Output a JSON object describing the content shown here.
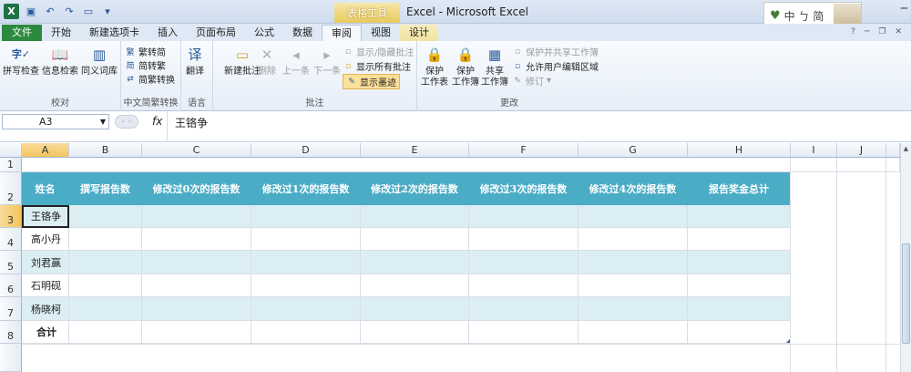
{
  "window": {
    "title": "Excel - Microsoft Excel",
    "context_tool": "表格工具",
    "ime_text": "中 ㄅ 简"
  },
  "tabs": [
    "文件",
    "开始",
    "新建选项卡",
    "插入",
    "页面布局",
    "公式",
    "数据",
    "审阅",
    "视图",
    "设计"
  ],
  "ribbon": {
    "proofing": {
      "label": "校对",
      "spell": "拼写检查",
      "info": "信息检索",
      "thesaurus": "同义词库"
    },
    "chinese": {
      "label": "中文简繁转换",
      "t2s": "繁转简",
      "s2t": "简转繁",
      "convert": "简繁转换"
    },
    "language": {
      "label": "语言",
      "translate": "翻译"
    },
    "comments": {
      "label": "批注",
      "new": "新建批注",
      "delete": "删除",
      "prev": "上一条",
      "next": "下一条",
      "show_hide": "显示/隐藏批注",
      "show_all": "显示所有批注",
      "show_ink": "显示墨迹"
    },
    "changes": {
      "label": "更改",
      "protect_sheet": "保护\n工作表",
      "protect_wb": "保护\n工作簿",
      "share_wb": "共享\n工作簿",
      "protect_share": "保护并共享工作簿",
      "allow_edit": "允许用户编辑区域",
      "track": "修订"
    }
  },
  "formula_bar": {
    "name_box": "A3",
    "fx": "fx",
    "value": "王铬争"
  },
  "columns": [
    "A",
    "B",
    "C",
    "D",
    "E",
    "F",
    "G",
    "H",
    "I",
    "J"
  ],
  "rows": [
    "1",
    "2",
    "3",
    "4",
    "5",
    "6",
    "7",
    "8"
  ],
  "table": {
    "headers": [
      "姓名",
      "撰写报告数",
      "修改过0次的报告数",
      "修改过1次的报告数",
      "修改过2次的报告数",
      "修改过3次的报告数",
      "修改过4次的报告数",
      "报告奖金总计"
    ],
    "names": [
      "王铬争",
      "高小丹",
      "刘君赢",
      "石明砚",
      "杨晓柯"
    ],
    "total": "合计"
  },
  "colors": {
    "header_fill": "#4bacc6",
    "band_fill": "#dbeef3",
    "file_tab": "#2a8a3e"
  }
}
